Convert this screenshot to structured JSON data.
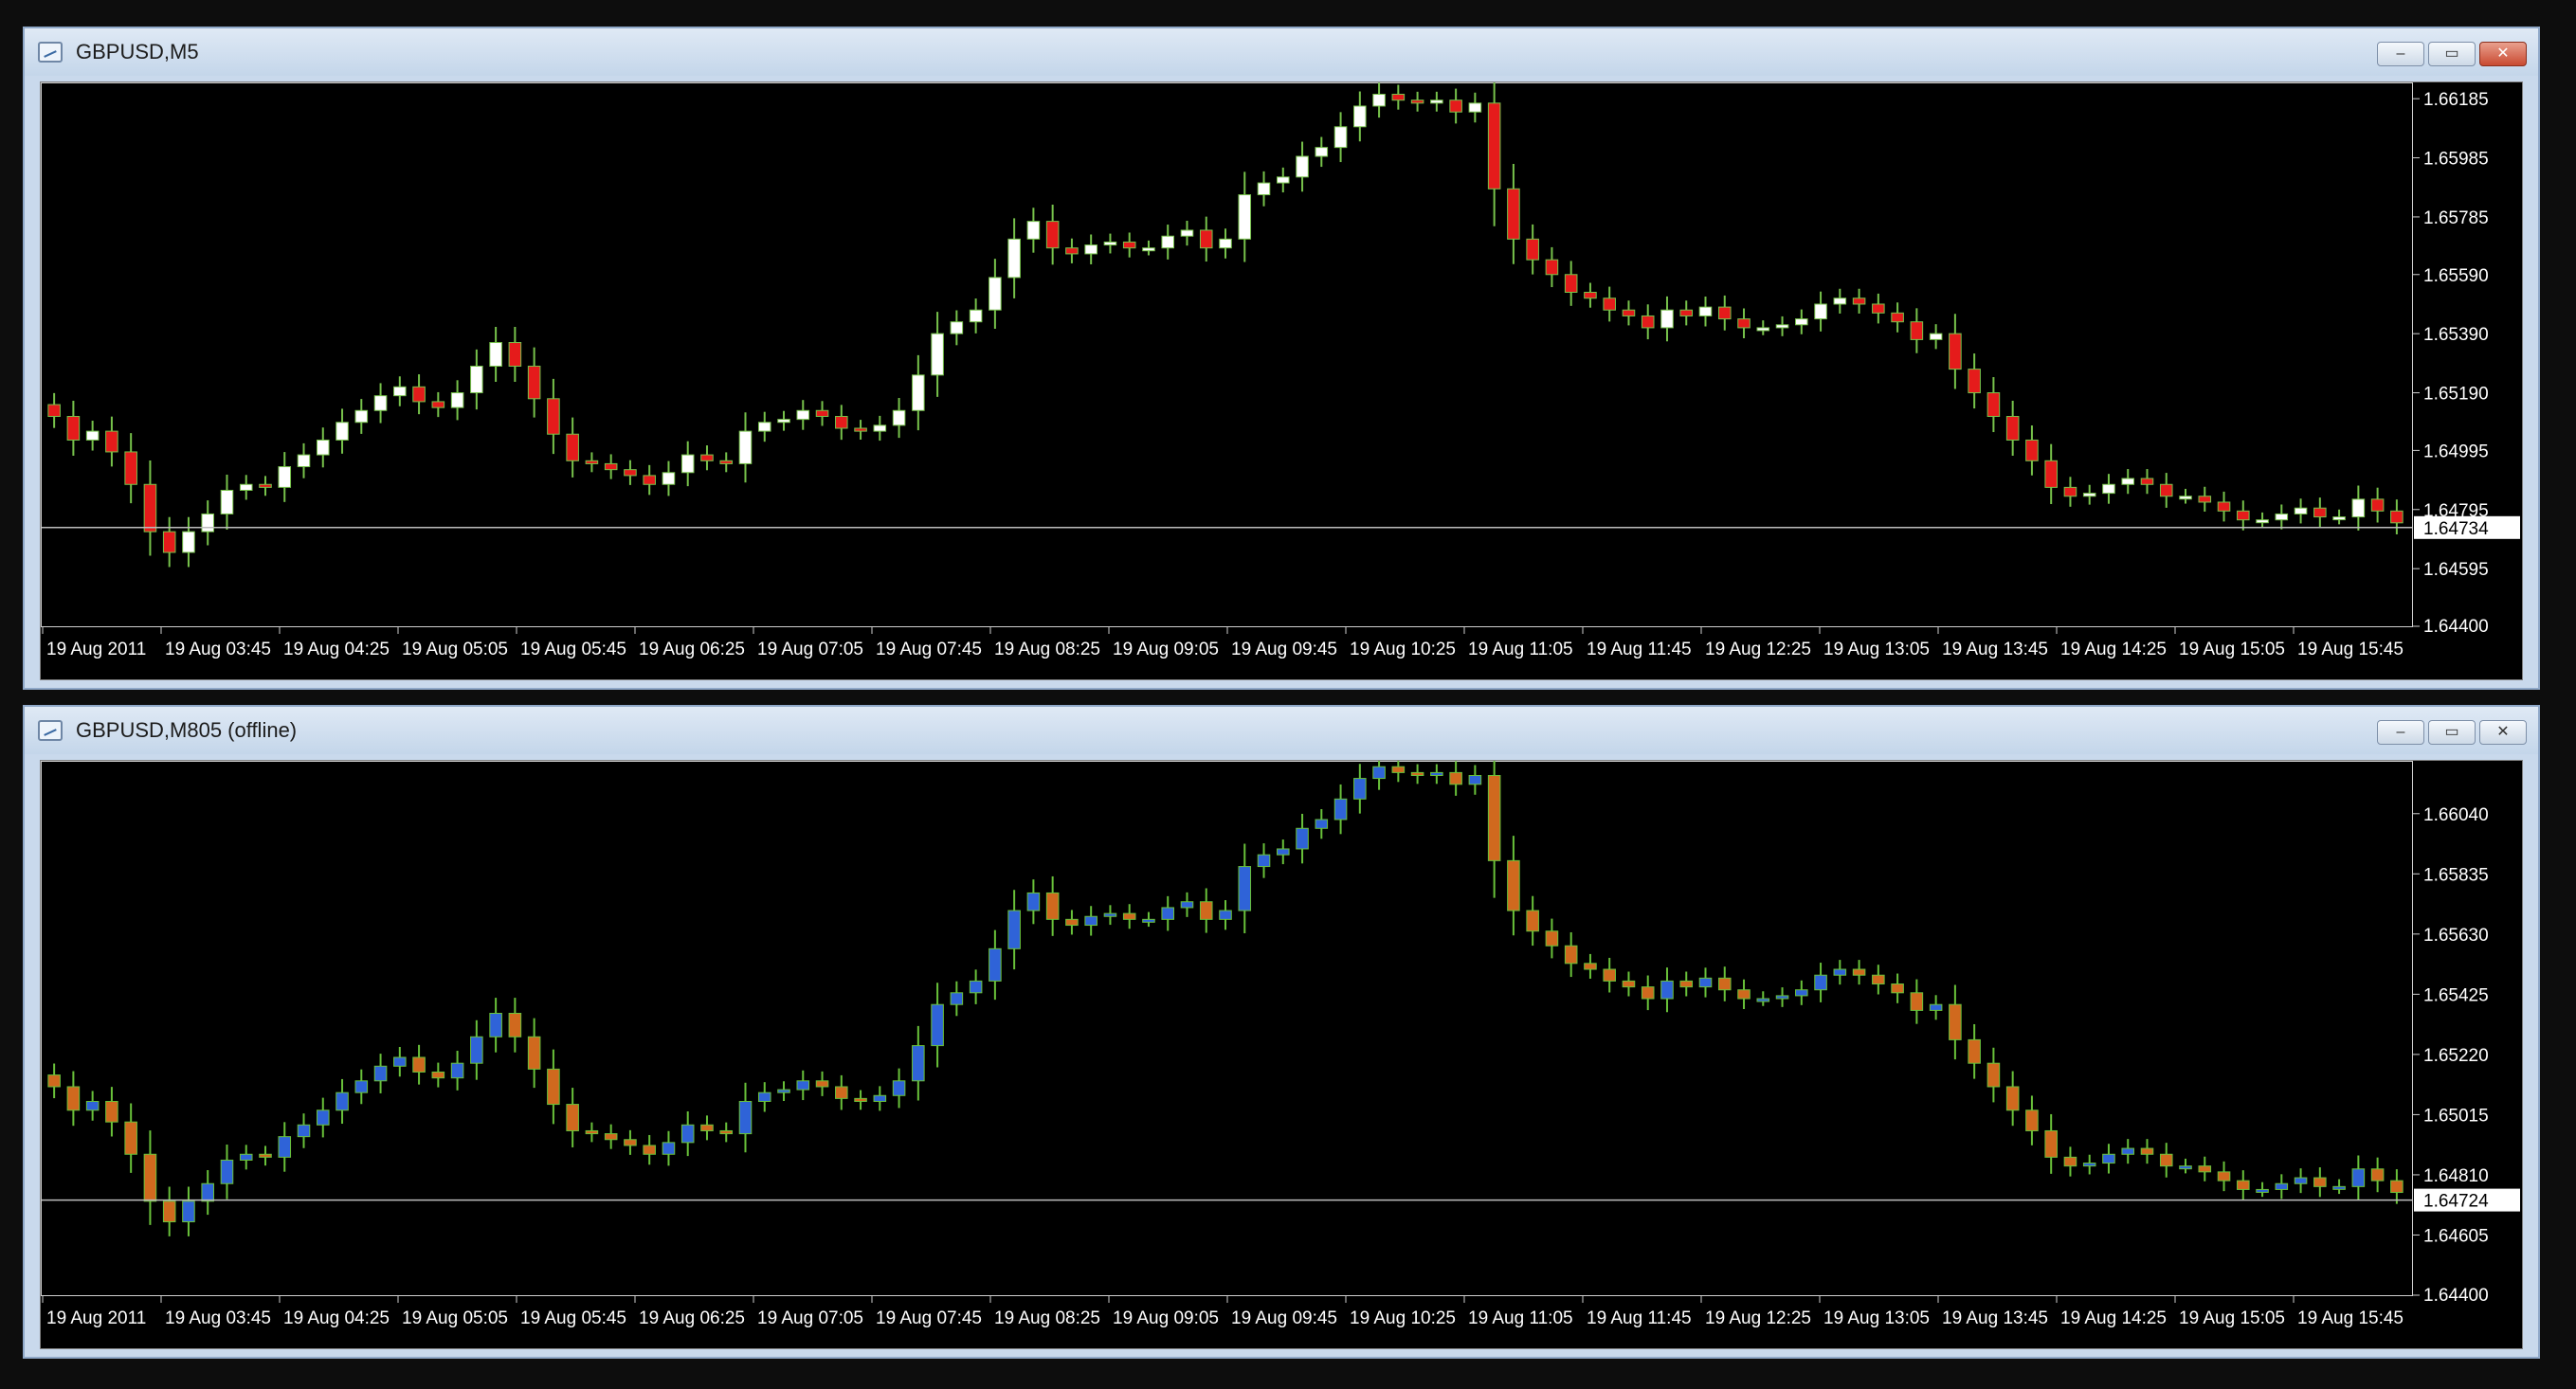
{
  "colors": {
    "bull_body_1": "#ffffff",
    "bear_body_1": "#e51b1b",
    "wick_1": "#77c24b",
    "bull_body_2": "#2f63d8",
    "bear_body_2": "#d0691e",
    "wick_2": "#69c13a",
    "axis_text": "#ffffff",
    "price_line": "#bdbdbd"
  },
  "windows": [
    {
      "title": "GBPUSD,M5",
      "buttons": {
        "minimize": "–",
        "maximize": "▭",
        "close": "✕"
      },
      "chart_data": {
        "type": "candlestick",
        "symbol": "GBPUSD",
        "ylim": [
          1.644,
          1.6624
        ],
        "y_ticks": [
          "1.66185",
          "1.65985",
          "1.65785",
          "1.65590",
          "1.65390",
          "1.65190",
          "1.64995",
          "1.64795",
          "1.64595",
          "1.64400"
        ],
        "y_tick_values": [
          1.66185,
          1.65985,
          1.65785,
          1.6559,
          1.6539,
          1.6519,
          1.64995,
          1.64795,
          1.64595,
          1.644
        ],
        "x_ticks": [
          "19 Aug 2011",
          "19 Aug 03:45",
          "19 Aug 04:25",
          "19 Aug 05:05",
          "19 Aug 05:45",
          "19 Aug 06:25",
          "19 Aug 07:05",
          "19 Aug 07:45",
          "19 Aug 08:25",
          "19 Aug 09:05",
          "19 Aug 09:45",
          "19 Aug 10:25",
          "19 Aug 11:05",
          "19 Aug 11:45",
          "19 Aug 12:25",
          "19 Aug 13:05",
          "19 Aug 13:45",
          "19 Aug 14:25",
          "19 Aug 15:05",
          "19 Aug 15:45"
        ],
        "last_price": "1.64734",
        "last_price_value": 1.64734,
        "close_path": [
          1.6511,
          1.6503,
          1.6506,
          1.6499,
          1.6488,
          1.6472,
          1.6465,
          1.6472,
          1.6478,
          1.6486,
          1.6488,
          1.6487,
          1.6494,
          1.6498,
          1.6503,
          1.6509,
          1.6513,
          1.6518,
          1.6521,
          1.6516,
          1.6514,
          1.6519,
          1.6528,
          1.6536,
          1.6528,
          1.6517,
          1.6505,
          1.6496,
          1.6495,
          1.6493,
          1.6491,
          1.6488,
          1.6492,
          1.6498,
          1.6496,
          1.6495,
          1.6506,
          1.6509,
          1.651,
          1.6513,
          1.6511,
          1.6507,
          1.6506,
          1.6508,
          1.6513,
          1.6525,
          1.6539,
          1.6543,
          1.6547,
          1.6558,
          1.6571,
          1.6577,
          1.6568,
          1.6566,
          1.6569,
          1.657,
          1.6568,
          1.6568,
          1.6572,
          1.6574,
          1.6568,
          1.6571,
          1.6586,
          1.659,
          1.6592,
          1.6599,
          1.6602,
          1.6609,
          1.6616,
          1.662,
          1.6618,
          1.6617,
          1.6618,
          1.6614,
          1.6617,
          1.6588,
          1.6571,
          1.6564,
          1.6559,
          1.6553,
          1.6551,
          1.6547,
          1.6545,
          1.6541,
          1.6547,
          1.6545,
          1.6548,
          1.6544,
          1.6541,
          1.6541,
          1.6542,
          1.6544,
          1.6549,
          1.6551,
          1.6549,
          1.6546,
          1.6543,
          1.6537,
          1.6539,
          1.6527,
          1.6519,
          1.6511,
          1.6503,
          1.6496,
          1.6487,
          1.6484,
          1.6485,
          1.6488,
          1.649,
          1.6488,
          1.6484,
          1.6484,
          1.6482,
          1.6479,
          1.6476,
          1.6476,
          1.6478,
          1.648,
          1.6477,
          1.6477,
          1.6483,
          1.6479,
          1.6475
        ]
      }
    },
    {
      "title": "GBPUSD,M805 (offline)",
      "buttons": {
        "minimize": "–",
        "maximize": "▭",
        "close": "✕"
      },
      "chart_data": {
        "type": "candlestick",
        "symbol": "GBPUSD",
        "ylim": [
          1.644,
          1.6622
        ],
        "y_ticks": [
          "1.66040",
          "1.65835",
          "1.65630",
          "1.65425",
          "1.65220",
          "1.65015",
          "1.64810",
          "1.64605",
          "1.64400"
        ],
        "y_tick_values": [
          1.6604,
          1.65835,
          1.6563,
          1.65425,
          1.6522,
          1.65015,
          1.6481,
          1.64605,
          1.644
        ],
        "x_ticks": [
          "19 Aug 2011",
          "19 Aug 03:45",
          "19 Aug 04:25",
          "19 Aug 05:05",
          "19 Aug 05:45",
          "19 Aug 06:25",
          "19 Aug 07:05",
          "19 Aug 07:45",
          "19 Aug 08:25",
          "19 Aug 09:05",
          "19 Aug 09:45",
          "19 Aug 10:25",
          "19 Aug 11:05",
          "19 Aug 11:45",
          "19 Aug 12:25",
          "19 Aug 13:05",
          "19 Aug 13:45",
          "19 Aug 14:25",
          "19 Aug 15:05",
          "19 Aug 15:45"
        ],
        "last_price": "1.64724",
        "last_price_value": 1.64724,
        "close_path": [
          1.6511,
          1.6503,
          1.6506,
          1.6499,
          1.6488,
          1.6472,
          1.6465,
          1.6472,
          1.6478,
          1.6486,
          1.6488,
          1.6487,
          1.6494,
          1.6498,
          1.6503,
          1.6509,
          1.6513,
          1.6518,
          1.6521,
          1.6516,
          1.6514,
          1.6519,
          1.6528,
          1.6536,
          1.6528,
          1.6517,
          1.6505,
          1.6496,
          1.6495,
          1.6493,
          1.6491,
          1.6488,
          1.6492,
          1.6498,
          1.6496,
          1.6495,
          1.6506,
          1.6509,
          1.651,
          1.6513,
          1.6511,
          1.6507,
          1.6506,
          1.6508,
          1.6513,
          1.6525,
          1.6539,
          1.6543,
          1.6547,
          1.6558,
          1.6571,
          1.6577,
          1.6568,
          1.6566,
          1.6569,
          1.657,
          1.6568,
          1.6568,
          1.6572,
          1.6574,
          1.6568,
          1.6571,
          1.6586,
          1.659,
          1.6592,
          1.6599,
          1.6602,
          1.6609,
          1.6616,
          1.662,
          1.6618,
          1.6617,
          1.6618,
          1.6614,
          1.6617,
          1.6588,
          1.6571,
          1.6564,
          1.6559,
          1.6553,
          1.6551,
          1.6547,
          1.6545,
          1.6541,
          1.6547,
          1.6545,
          1.6548,
          1.6544,
          1.6541,
          1.6541,
          1.6542,
          1.6544,
          1.6549,
          1.6551,
          1.6549,
          1.6546,
          1.6543,
          1.6537,
          1.6539,
          1.6527,
          1.6519,
          1.6511,
          1.6503,
          1.6496,
          1.6487,
          1.6484,
          1.6485,
          1.6488,
          1.649,
          1.6488,
          1.6484,
          1.6484,
          1.6482,
          1.6479,
          1.6476,
          1.6476,
          1.6478,
          1.648,
          1.6477,
          1.6477,
          1.6483,
          1.6479,
          1.6475
        ]
      }
    }
  ]
}
